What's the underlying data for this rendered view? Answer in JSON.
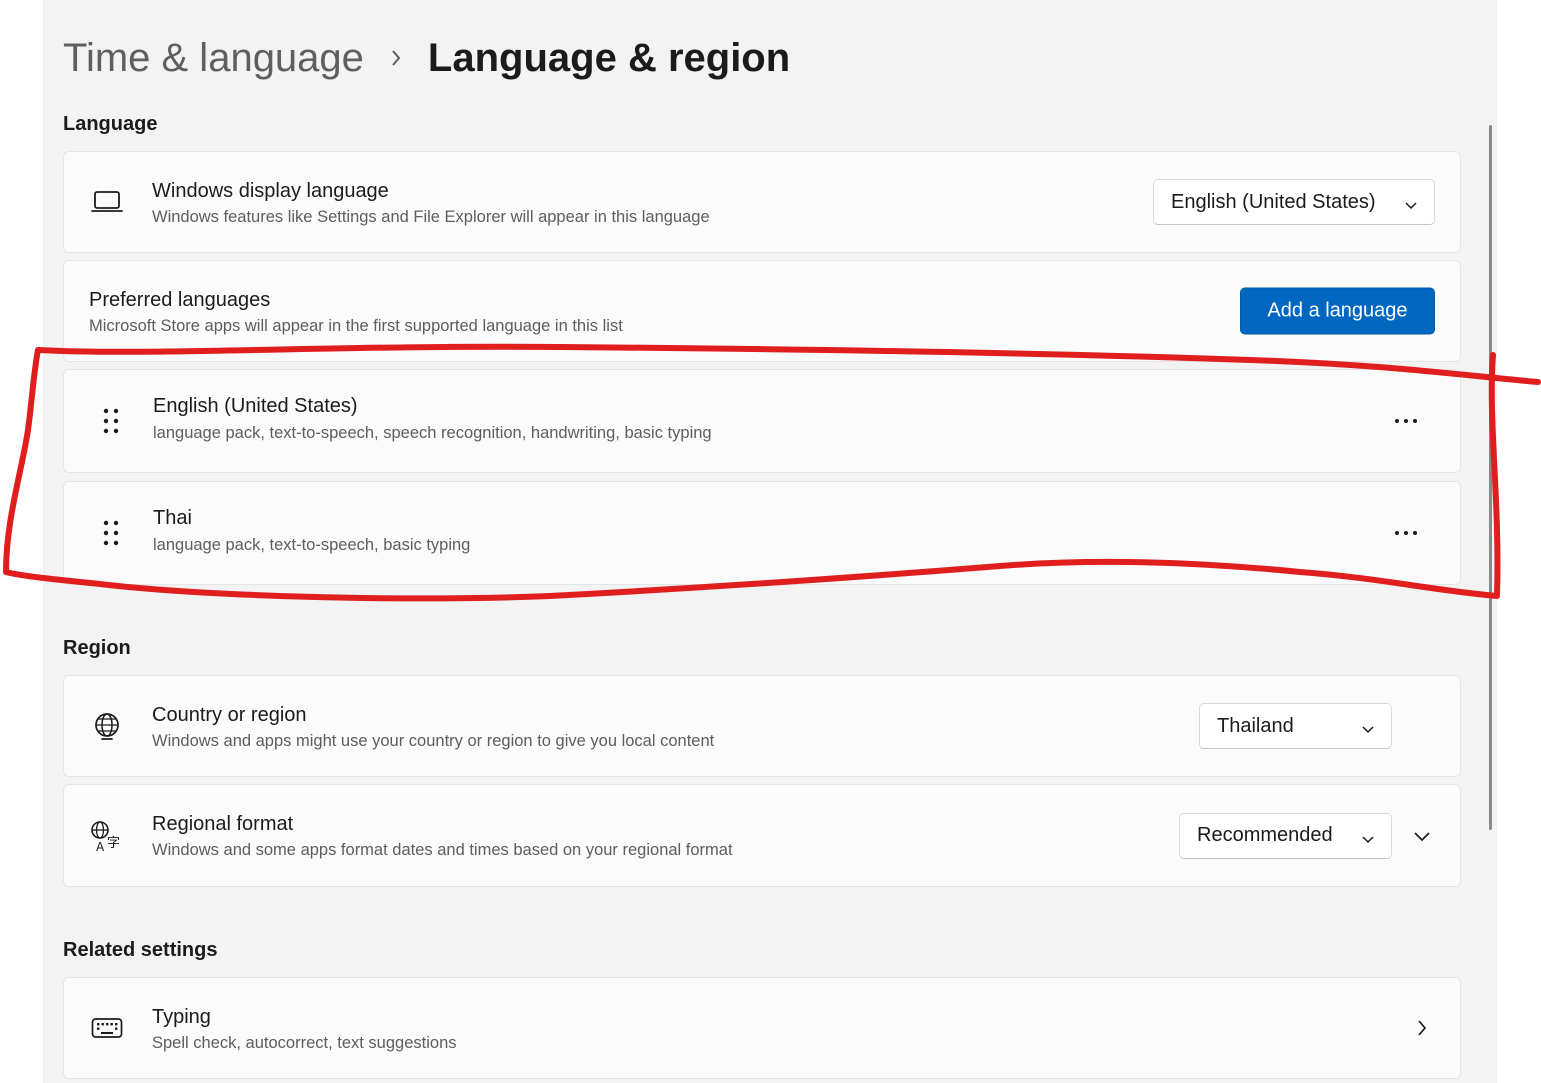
{
  "breadcrumb": {
    "parent": "Time & language",
    "current": "Language & region"
  },
  "language_section": {
    "title": "Language",
    "display_language": {
      "title": "Windows display language",
      "description": "Windows features like Settings and File Explorer will appear in this language",
      "value": "English (United States)",
      "icon": "laptop-icon"
    },
    "preferred": {
      "title": "Preferred languages",
      "description": "Microsoft Store apps will appear in the first supported language in this list",
      "add_button": "Add a language"
    },
    "languages": [
      {
        "name": "English (United States)",
        "features": "language pack, text-to-speech, speech recognition, handwriting, basic typing"
      },
      {
        "name": "Thai",
        "features": "language pack, text-to-speech, basic typing"
      }
    ]
  },
  "region_section": {
    "title": "Region",
    "country": {
      "title": "Country or region",
      "description": "Windows and apps might use your country or region to give you local content",
      "value": "Thailand",
      "icon": "globe-icon"
    },
    "format": {
      "title": "Regional format",
      "description": "Windows and some apps format dates and times based on your regional format",
      "value": "Recommended",
      "icon": "language-format-icon"
    }
  },
  "related_section": {
    "title": "Related settings",
    "typing": {
      "title": "Typing",
      "description": "Spell check, autocorrect, text suggestions",
      "icon": "keyboard-icon"
    }
  },
  "colors": {
    "accent": "#0067c0",
    "annotation": "#e01e1e",
    "background": "#f3f3f3",
    "card": "#fbfbfb"
  }
}
